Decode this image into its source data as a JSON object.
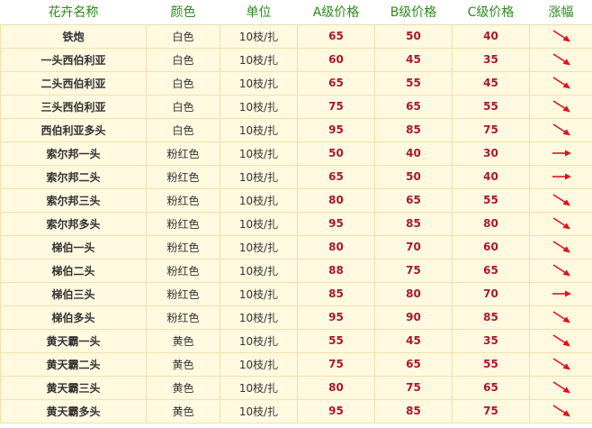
{
  "colors": {
    "header_text": "#2c8a1a",
    "row_bg": "#fff9e0",
    "border": "#efe2ad",
    "price": "#a8182c",
    "arrow": "#e0121a"
  },
  "headers": [
    "花卉名称",
    "颜色",
    "单位",
    "A级价格",
    "B级价格",
    "C级价格",
    "涨幅"
  ],
  "rows": [
    {
      "name": "铁炮",
      "color": "白色",
      "unit": "10枝/扎",
      "a": "65",
      "b": "50",
      "c": "40",
      "trend": "down"
    },
    {
      "name": "一头西伯利亚",
      "color": "白色",
      "unit": "10枝/扎",
      "a": "60",
      "b": "45",
      "c": "35",
      "trend": "down"
    },
    {
      "name": "二头西伯利亚",
      "color": "白色",
      "unit": "10枝/扎",
      "a": "65",
      "b": "55",
      "c": "45",
      "trend": "down"
    },
    {
      "name": "三头西伯利亚",
      "color": "白色",
      "unit": "10枝/扎",
      "a": "75",
      "b": "65",
      "c": "55",
      "trend": "down"
    },
    {
      "name": "西伯利亚多头",
      "color": "白色",
      "unit": "10枝/扎",
      "a": "95",
      "b": "85",
      "c": "75",
      "trend": "down"
    },
    {
      "name": "索尔邦一头",
      "color": "粉红色",
      "unit": "10枝/扎",
      "a": "50",
      "b": "40",
      "c": "30",
      "trend": "flat"
    },
    {
      "name": "索尔邦二头",
      "color": "粉红色",
      "unit": "10枝/扎",
      "a": "65",
      "b": "50",
      "c": "40",
      "trend": "flat"
    },
    {
      "name": "索尔邦三头",
      "color": "粉红色",
      "unit": "10枝/扎",
      "a": "80",
      "b": "65",
      "c": "55",
      "trend": "down"
    },
    {
      "name": "索尔邦多头",
      "color": "粉红色",
      "unit": "10枝/扎",
      "a": "95",
      "b": "85",
      "c": "80",
      "trend": "down"
    },
    {
      "name": "梯伯一头",
      "color": "粉红色",
      "unit": "10枝/扎",
      "a": "80",
      "b": "70",
      "c": "60",
      "trend": "down"
    },
    {
      "name": "梯伯二头",
      "color": "粉红色",
      "unit": "10枝/扎",
      "a": "88",
      "b": "75",
      "c": "65",
      "trend": "down"
    },
    {
      "name": "梯伯三头",
      "color": "粉红色",
      "unit": "10枝/扎",
      "a": "85",
      "b": "80",
      "c": "70",
      "trend": "flat"
    },
    {
      "name": "梯伯多头",
      "color": "粉红色",
      "unit": "10枝/扎",
      "a": "95",
      "b": "90",
      "c": "85",
      "trend": "down"
    },
    {
      "name": "黄天霸一头",
      "color": "黄色",
      "unit": "10枝/扎",
      "a": "55",
      "b": "45",
      "c": "35",
      "trend": "down"
    },
    {
      "name": "黄天霸二头",
      "color": "黄色",
      "unit": "10枝/扎",
      "a": "75",
      "b": "65",
      "c": "55",
      "trend": "down"
    },
    {
      "name": "黄天霸三头",
      "color": "黄色",
      "unit": "10枝/扎",
      "a": "80",
      "b": "75",
      "c": "65",
      "trend": "down"
    },
    {
      "name": "黄天霸多头",
      "color": "黄色",
      "unit": "10枝/扎",
      "a": "95",
      "b": "85",
      "c": "75",
      "trend": "down"
    }
  ]
}
